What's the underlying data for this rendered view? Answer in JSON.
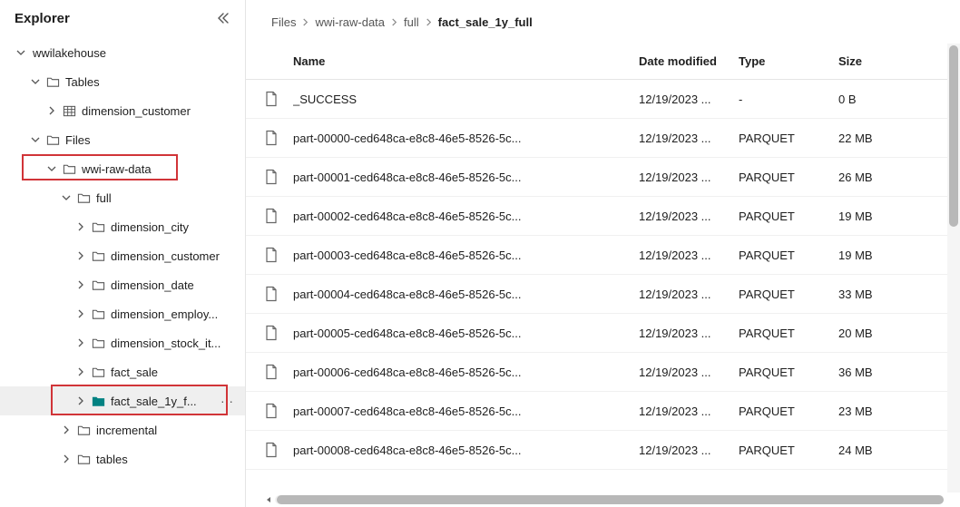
{
  "sidebar": {
    "title": "Explorer",
    "root": "wwilakehouse",
    "tables_label": "Tables",
    "dim_customer": "dimension_customer",
    "files_label": "Files",
    "wwi_raw": "wwi-raw-data",
    "full_label": "full",
    "children": [
      "dimension_city",
      "dimension_customer",
      "dimension_date",
      "dimension_employ...",
      "dimension_stock_it...",
      "fact_sale",
      "fact_sale_1y_f...",
      "incremental",
      "tables"
    ]
  },
  "breadcrumb": [
    "Files",
    "wwi-raw-data",
    "full",
    "fact_sale_1y_full"
  ],
  "columns": {
    "name": "Name",
    "date": "Date modified",
    "type": "Type",
    "size": "Size"
  },
  "files": [
    {
      "name": "_SUCCESS",
      "date": "12/19/2023 ...",
      "type": "-",
      "size": "0 B"
    },
    {
      "name": "part-00000-ced648ca-e8c8-46e5-8526-5c...",
      "date": "12/19/2023 ...",
      "type": "PARQUET",
      "size": "22 MB"
    },
    {
      "name": "part-00001-ced648ca-e8c8-46e5-8526-5c...",
      "date": "12/19/2023 ...",
      "type": "PARQUET",
      "size": "26 MB"
    },
    {
      "name": "part-00002-ced648ca-e8c8-46e5-8526-5c...",
      "date": "12/19/2023 ...",
      "type": "PARQUET",
      "size": "19 MB"
    },
    {
      "name": "part-00003-ced648ca-e8c8-46e5-8526-5c...",
      "date": "12/19/2023 ...",
      "type": "PARQUET",
      "size": "19 MB"
    },
    {
      "name": "part-00004-ced648ca-e8c8-46e5-8526-5c...",
      "date": "12/19/2023 ...",
      "type": "PARQUET",
      "size": "33 MB"
    },
    {
      "name": "part-00005-ced648ca-e8c8-46e5-8526-5c...",
      "date": "12/19/2023 ...",
      "type": "PARQUET",
      "size": "20 MB"
    },
    {
      "name": "part-00006-ced648ca-e8c8-46e5-8526-5c...",
      "date": "12/19/2023 ...",
      "type": "PARQUET",
      "size": "36 MB"
    },
    {
      "name": "part-00007-ced648ca-e8c8-46e5-8526-5c...",
      "date": "12/19/2023 ...",
      "type": "PARQUET",
      "size": "23 MB"
    },
    {
      "name": "part-00008-ced648ca-e8c8-46e5-8526-5c...",
      "date": "12/19/2023 ...",
      "type": "PARQUET",
      "size": "24 MB"
    }
  ]
}
